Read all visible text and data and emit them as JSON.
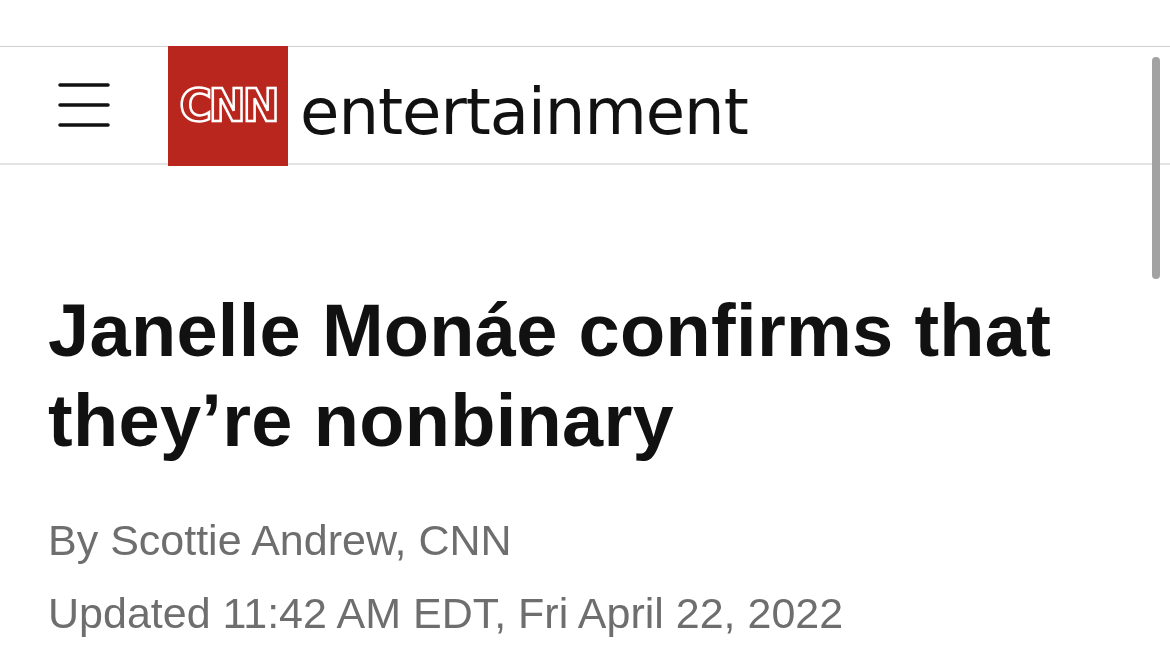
{
  "header": {
    "logo": "CNN",
    "section": "entertainment"
  },
  "article": {
    "headline": "Janelle Monáe confirms that they’re nonbinary",
    "byline": "By Scottie Andrew, CNN",
    "timestamp": "Updated 11:42 AM EDT, Fri April 22, 2022"
  }
}
